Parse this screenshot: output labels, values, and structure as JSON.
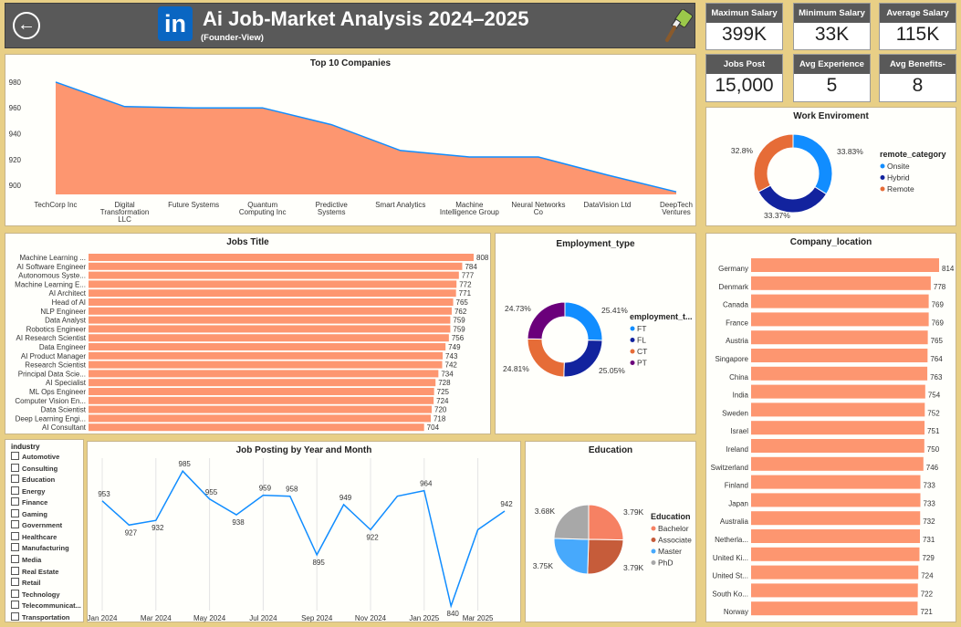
{
  "header": {
    "title": "Ai Job-Market Analysis 2024–2025",
    "subtitle": "(Founder-View)",
    "logo_text": "in",
    "back_icon": "←"
  },
  "kpis": [
    {
      "label": "Maximun Salary",
      "value": "399K"
    },
    {
      "label": "Minimum Salary",
      "value": "33K"
    },
    {
      "label": "Average Salary",
      "value": "115K"
    },
    {
      "label": "Jobs Post",
      "value": "15,000"
    },
    {
      "label": "Avg Experience",
      "value": "5"
    },
    {
      "label": "Avg Benefits-Score",
      "value": "8"
    }
  ],
  "colors": {
    "salmon": "#fd9670",
    "line_blue": "#118dff",
    "onsite": "#118dff",
    "hybrid": "#12239e",
    "remote": "#e66c37",
    "pt": "#6b007b",
    "bachelor": "#f68163",
    "associate": "#c65c3a",
    "master": "#47a9fc",
    "phd": "#a8a8a8"
  },
  "chart_data": [
    {
      "id": "top_companies",
      "type": "area",
      "title": "Top 10 Companies",
      "categories": [
        "TechCorp Inc",
        "Digital Transformation LLC",
        "Future Systems",
        "Quantum Computing Inc",
        "Predictive Systems",
        "Smart Analytics",
        "Machine Intelligence Group",
        "Neural Networks Co",
        "DataVision Ltd",
        "DeepTech Ventures"
      ],
      "category_lines": [
        [
          "TechCorp Inc"
        ],
        [
          "Digital",
          "Transformation",
          "LLC"
        ],
        [
          "Future Systems"
        ],
        [
          "Quantum",
          "Computing Inc"
        ],
        [
          "Predictive",
          "Systems"
        ],
        [
          "Smart Analytics"
        ],
        [
          "Machine",
          "Intelligence Group"
        ],
        [
          "Neural Networks",
          "Co"
        ],
        [
          "DataVision Ltd"
        ],
        [
          "DeepTech",
          "Ventures"
        ]
      ],
      "values": [
        980,
        961,
        960,
        960,
        947,
        927,
        922,
        922,
        908,
        895
      ],
      "ylim": [
        893,
        987
      ],
      "yticks": [
        900,
        920,
        940,
        960,
        980
      ],
      "grid": false
    },
    {
      "id": "jobs_title",
      "type": "bar",
      "orientation": "horizontal",
      "title": "Jobs Title",
      "categories": [
        "Machine Learning ...",
        "AI Software Engineer",
        "Autonomous Syste...",
        "Machine Learning E...",
        "AI Architect",
        "Head of AI",
        "NLP Engineer",
        "Data Analyst",
        "Robotics Engineer",
        "AI Research Scientist",
        "Data Engineer",
        "AI Product Manager",
        "Research Scientist",
        "Principal Data Scie...",
        "AI Specialist",
        "ML Ops Engineer",
        "Computer Vision En...",
        "Data Scientist",
        "Deep Learning Engi...",
        "AI Consultant"
      ],
      "values": [
        808,
        784,
        777,
        772,
        771,
        765,
        762,
        759,
        759,
        756,
        749,
        743,
        742,
        734,
        728,
        725,
        724,
        720,
        718,
        704
      ],
      "xlim": [
        0,
        808
      ]
    },
    {
      "id": "employment_type",
      "type": "pie",
      "donut": true,
      "title": "Employment_type",
      "legend_title": "employment_t...",
      "labels": [
        "FT",
        "FL",
        "CT",
        "PT"
      ],
      "values": [
        25.41,
        25.05,
        24.81,
        24.73
      ],
      "value_labels": [
        "25.41%",
        "25.05%",
        "24.81%",
        "24.73%"
      ],
      "colors": [
        "#118dff",
        "#12239e",
        "#e66c37",
        "#6b007b"
      ]
    },
    {
      "id": "work_environment",
      "type": "pie",
      "donut": true,
      "title": "Work Enviroment",
      "legend_title": "remote_category",
      "labels": [
        "Onsite",
        "Hybrid",
        "Remote"
      ],
      "values": [
        33.83,
        33.37,
        32.8
      ],
      "value_labels": [
        "33.83%",
        "33.37%",
        "32.8%"
      ],
      "colors": [
        "#118dff",
        "#12239e",
        "#e66c37"
      ]
    },
    {
      "id": "company_location",
      "type": "bar",
      "orientation": "horizontal",
      "title": "Company_location",
      "categories": [
        "Germany",
        "Denmark",
        "Canada",
        "France",
        "Austria",
        "Singapore",
        "China",
        "India",
        "Sweden",
        "Israel",
        "Ireland",
        "Switzerland",
        "Finland",
        "Japan",
        "Australia",
        "Netherla...",
        "United Ki...",
        "United St...",
        "South Ko...",
        "Norway"
      ],
      "values": [
        814,
        778,
        769,
        769,
        765,
        764,
        763,
        754,
        752,
        751,
        750,
        746,
        733,
        733,
        732,
        731,
        729,
        724,
        722,
        721
      ],
      "xlim": [
        0,
        814
      ]
    },
    {
      "id": "job_posting_by_month",
      "type": "line",
      "title": "Job Posting by Year and Month",
      "x": [
        "Jan 2024",
        "Feb 2024",
        "Mar 2024",
        "Apr 2024",
        "May 2024",
        "Jun 2024",
        "Jul 2024",
        "Aug 2024",
        "Sep 2024",
        "Oct 2024",
        "Nov 2024",
        "Dec 2024",
        "Jan 2025",
        "Feb 2025",
        "Mar 2025",
        "Apr 2025"
      ],
      "values": [
        953,
        927,
        932,
        985,
        955,
        938,
        959,
        958,
        895,
        949,
        922,
        958,
        964,
        840,
        922,
        942
      ],
      "point_labels": [
        "953",
        "927",
        "932",
        "985",
        "955",
        "938",
        "959",
        "958",
        "895",
        "949",
        "922",
        "",
        "964",
        "840",
        "",
        "942"
      ],
      "xticks": [
        "Jan 2024",
        "Mar 2024",
        "May 2024",
        "Jul 2024",
        "Sep 2024",
        "Nov 2024",
        "Jan 2025",
        "Mar 2025"
      ],
      "ylim": [
        835,
        995
      ],
      "grid": true
    },
    {
      "id": "education",
      "type": "pie",
      "title": "Education",
      "legend_title": "Education",
      "labels": [
        "Bachelor",
        "Associate",
        "Master",
        "PhD"
      ],
      "values": [
        3.79,
        3.79,
        3.75,
        3.68
      ],
      "value_labels": [
        "3.79K",
        "3.79K",
        "3.75K",
        "3.68K"
      ],
      "colors": [
        "#f68163",
        "#c65c3a",
        "#47a9fc",
        "#a8a8a8"
      ]
    }
  ],
  "slicer": {
    "title": "industry",
    "items": [
      "Automotive",
      "Consulting",
      "Education",
      "Energy",
      "Finance",
      "Gaming",
      "Government",
      "Healthcare",
      "Manufacturing",
      "Media",
      "Real Estate",
      "Retail",
      "Technology",
      "Telecommunicat...",
      "Transportation"
    ]
  }
}
